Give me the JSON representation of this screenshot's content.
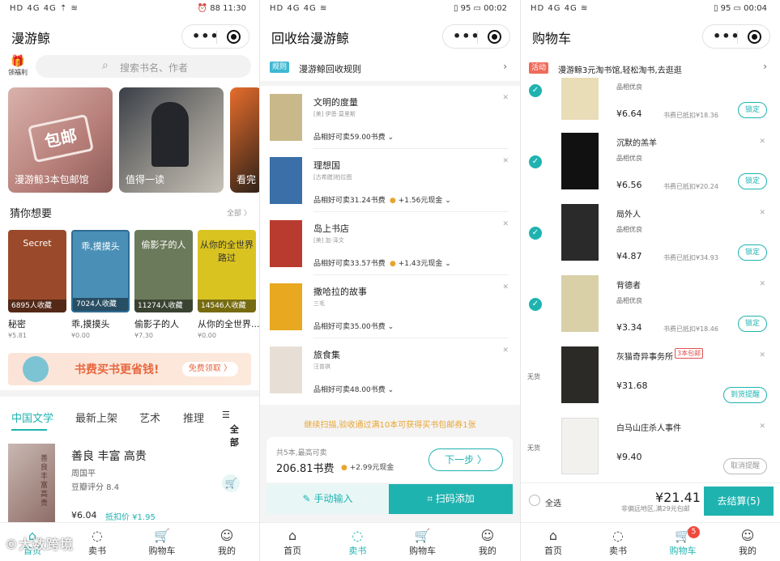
{
  "status": {
    "p1": {
      "left": "HD 4G 4G ⇡ ≋",
      "right": "⏰ 88 11:30"
    },
    "p2": {
      "left": "HD 4G 4G ≋",
      "right": "▯ 95 ▭ 00:02"
    },
    "p3": {
      "left": "HD 4G 4G ≋",
      "right": "▯ 95 ▭ 00:04"
    }
  },
  "p1": {
    "title": "漫游鲸",
    "gift": {
      "label": "领福利",
      "icon": "gift-icon"
    },
    "search_placeholder": "搜索书名、作者",
    "banners": [
      {
        "label": "漫游鲸3本包邮馆",
        "stamp": "包邮"
      },
      {
        "label": "值得一读"
      },
      {
        "label": "看完"
      }
    ],
    "guess": {
      "heading": "猜你想要",
      "more": "全部 〉"
    },
    "books": [
      {
        "cover_text": "Secret",
        "count": "6895人收藏",
        "title": "秘密",
        "price": "¥5.81",
        "color": "#9a4a2a"
      },
      {
        "cover_text": "乖,摸摸头",
        "count": "7024人收藏",
        "title": "乖,摸摸头",
        "price": "¥0.00",
        "color": "#4a8fb6"
      },
      {
        "cover_text": "偷影子的人",
        "count": "11274人收藏",
        "title": "偷影子的人",
        "price": "¥7.30",
        "color": "#6b7a5a"
      },
      {
        "cover_text": "从你的全世界路过",
        "count": "14546人收藏",
        "title": "从你的全世界...",
        "price": "¥0.00",
        "color": "#d9c321"
      }
    ],
    "promo": {
      "text": "书费买书更省钱!",
      "button": "免费领取 〉"
    },
    "categories": [
      "中国文学",
      "最新上架",
      "艺术",
      "推理"
    ],
    "all_label": "全部",
    "featured": {
      "title": "善良 丰富 高贵",
      "author": "周国平",
      "score": "豆瓣评分 8.4",
      "price": "¥6.04",
      "discount": "抵扣价 ¥1.95",
      "cover_text": "善良丰富高贵"
    },
    "watermark": "©大数跨境"
  },
  "p2": {
    "title": "回收给漫游鲸",
    "rule_tag": "规则",
    "rule_text": "漫游鲸回收规则",
    "items": [
      {
        "name": "文明的度量",
        "author": "[美] 伊恩·莫里斯",
        "price": "品相好可卖59.00书费",
        "cash": "",
        "color": "#c9b98a"
      },
      {
        "name": "理想国",
        "author": "[古希腊]柏拉图",
        "price": "品相好可卖31.24书费",
        "cash": "+1.56元现金",
        "color": "#3a6fa8"
      },
      {
        "name": "岛上书店",
        "author": "[美] 加·泽文",
        "price": "品相好可卖33.57书费",
        "cash": "+1.43元现金",
        "color": "#b93a2e"
      },
      {
        "name": "撒哈拉的故事",
        "author": "三毛",
        "price": "品相好可卖35.00书费",
        "cash": "",
        "color": "#e8a820"
      },
      {
        "name": "旅食集",
        "author": "汪曾祺",
        "price": "品相好可卖48.00书费",
        "cash": "",
        "color": "#e7dfd6"
      }
    ],
    "hint": "继续扫描,验收通过满10本可获得买书包邮券1张",
    "summary": {
      "count": "共5本,最高可卖",
      "fee": "206.81书费",
      "cash": "+2.99元现金",
      "next": "下一步 〉"
    },
    "manual": "手动输入",
    "scan": "扫码添加"
  },
  "p3": {
    "title": "购物车",
    "act_tag": "活动",
    "act_text": "漫游鲸3元淘书馆,轻松淘书,去逛逛",
    "items": [
      {
        "name": "",
        "quality": "品相优良",
        "price": "¥6.64",
        "saved": "书费已抵扣¥18.36",
        "button": "锁定",
        "checked": true,
        "color": "#e9ddb8"
      },
      {
        "name": "沉默的羔羊",
        "quality": "品相优良",
        "price": "¥6.56",
        "saved": "书费已抵扣¥20.24",
        "button": "锁定",
        "checked": true,
        "color": "#111"
      },
      {
        "name": "局外人",
        "quality": "品相优良",
        "price": "¥4.87",
        "saved": "书费已抵扣¥34.93",
        "button": "锁定",
        "checked": true,
        "color": "#2a2a2a"
      },
      {
        "name": "背德者",
        "quality": "品相优良",
        "price": "¥3.34",
        "saved": "书费已抵扣¥18.46",
        "button": "锁定",
        "checked": true,
        "color": "#d9d0a8"
      },
      {
        "name": "灰猫奇异事务所",
        "tag": "3本包邮",
        "price": "¥31.68",
        "button": "到货提醒",
        "stock": "无货",
        "color": "#2c2a27"
      },
      {
        "name": "白马山庄杀人事件",
        "price": "¥9.40",
        "button": "取消提醒",
        "stock": "无货",
        "color": "#f3f1ee"
      }
    ],
    "select_all": "全选",
    "total": "¥21.41",
    "total_sub": "非偏远地区,满29元包邮",
    "checkout": "去结算(5)"
  },
  "tabs": [
    "首页",
    "卖书",
    "购物车",
    "我的"
  ],
  "cart_badge": "5"
}
